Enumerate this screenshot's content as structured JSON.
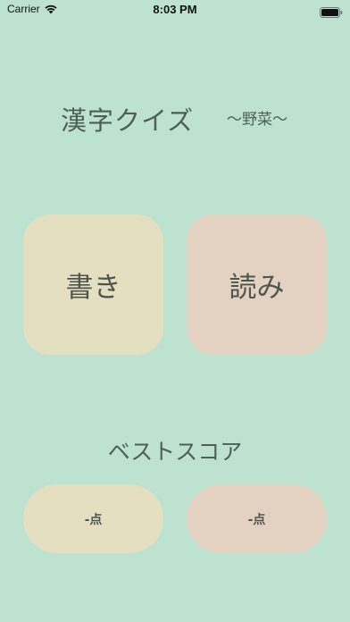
{
  "status_bar": {
    "carrier": "Carrier",
    "time": "8:03 PM",
    "wifi_icon": "wifi-icon",
    "battery_icon": "battery-icon"
  },
  "header": {
    "title": "漢字クイズ",
    "subtitle": "〜野菜〜"
  },
  "modes": {
    "write_label": "書き",
    "read_label": "読み"
  },
  "best_score": {
    "label": "ベストスコア",
    "write_score": "-点",
    "read_score": "-点"
  },
  "colors": {
    "background": "#bde3d0",
    "write_tile": "#e4dfc0",
    "read_tile": "#e3d1c1"
  }
}
